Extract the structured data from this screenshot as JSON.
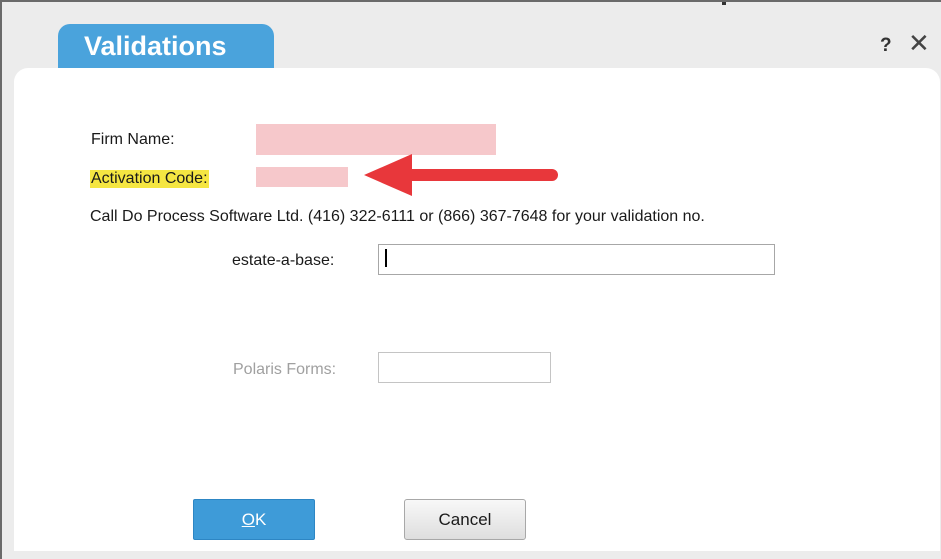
{
  "dialog": {
    "title": "Validations",
    "help_label": "?",
    "close_label": "✕"
  },
  "fields": {
    "firm_name_label": "Firm Name:",
    "activation_code_label": "Activation Code:",
    "info_text": "Call Do Process Software Ltd. (416) 322-6111 or (866) 367-7648 for your validation no.",
    "estate_label": "estate-a-base:",
    "estate_value": "",
    "polaris_label": "Polaris Forms:",
    "polaris_value": ""
  },
  "buttons": {
    "ok_mnemonic": "O",
    "ok_rest": "K",
    "cancel_label": "Cancel"
  },
  "colors": {
    "title_tab": "#4aa3dc",
    "ok_button": "#3e9bd8",
    "highlight": "#f5e642",
    "arrow": "#e8373b",
    "redaction": "#f6c8cb"
  },
  "icons": {
    "help": "question-mark-icon",
    "close": "close-icon",
    "annotation": "red-arrow-icon"
  }
}
